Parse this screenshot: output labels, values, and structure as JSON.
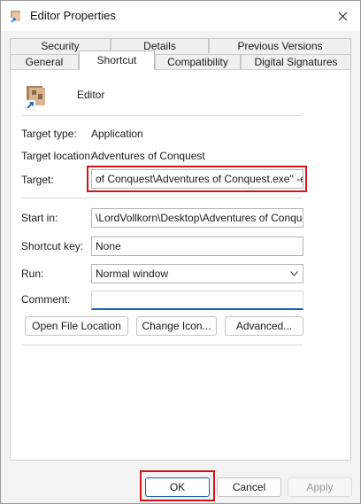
{
  "window": {
    "title": "Editor Properties"
  },
  "tabs": {
    "row1": [
      "Security",
      "Details",
      "Previous Versions"
    ],
    "row2": [
      "General",
      "Shortcut",
      "Compatibility",
      "Digital Signatures"
    ],
    "active": "Shortcut"
  },
  "shortcut": {
    "name": "Editor",
    "target_type_label": "Target type:",
    "target_type": "Application",
    "target_location_label": "Target location:",
    "target_location": "Adventures of Conquest",
    "target_label": "Target:",
    "target": "of Conquest\\Adventures of Conquest.exe\" -editor",
    "start_in_label": "Start in:",
    "start_in": "\\LordVollkorn\\Desktop\\Adventures of Conquest\"",
    "shortcut_key_label": "Shortcut key:",
    "shortcut_key": "None",
    "run_label": "Run:",
    "run": "Normal window",
    "comment_label": "Comment:",
    "comment": ""
  },
  "buttons": {
    "open_location": "Open File Location",
    "change_icon": "Change Icon...",
    "advanced": "Advanced...",
    "ok": "OK",
    "cancel": "Cancel",
    "apply": "Apply"
  },
  "colors": {
    "highlight": "#d0141c",
    "focus": "#1a5fb4"
  },
  "icons": {
    "title": "shortcut-file-icon",
    "close": "close-icon",
    "app": "app-shortcut-icon",
    "dropdown": "chevron-down-icon"
  }
}
